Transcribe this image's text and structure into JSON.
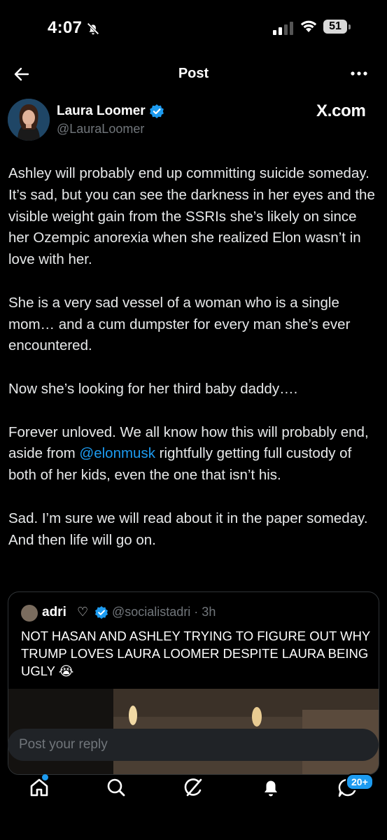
{
  "status_bar": {
    "time": "4:07",
    "battery": "51"
  },
  "header": {
    "title": "Post"
  },
  "author": {
    "name": "Laura Loomer",
    "handle": "@LauraLoomer",
    "source": "X.com"
  },
  "post": {
    "paragraphs": [
      "Ashley will probably end up committing suicide someday. It’s sad, but you can see the darkness in her eyes and the visible weight gain from the SSRIs she’s likely on since her Ozempic anorexia when she realized Elon wasn’t in love with her.",
      "She is a very  sad vessel of a woman who is a single mom… and a cum dumpster for every man she’s ever encountered.",
      "Now she’s looking for her third baby daddy….",
      "Sad. I’m sure we will read about it in the paper someday. And then life will go on."
    ],
    "p4_before": "Forever unloved. We all know how this will probably end, aside from ",
    "p4_mention": "@elonmusk",
    "p4_after": " rightfully getting full custody of both of her kids, even the one that isn’t his."
  },
  "quote": {
    "name": "adri",
    "heart": "♡",
    "handle_time": "@socialistadri · 3h",
    "text": "NOT HASAN AND ASHLEY TRYING TO FIGURE OUT WHY TRUMP LOVES LAURA LOOMER DESPITE LAURA BEING UGLY 😭"
  },
  "reply": {
    "placeholder": "Post your reply"
  },
  "nav": {
    "messages_badge": "20+"
  },
  "colors": {
    "accent": "#1d9bf0",
    "background": "#000000",
    "secondary_text": "#71767b"
  },
  "icons": [
    "back-arrow-icon",
    "more-icon",
    "verified-icon",
    "home-icon",
    "search-icon",
    "grok-icon",
    "bell-icon",
    "messages-icon"
  ]
}
